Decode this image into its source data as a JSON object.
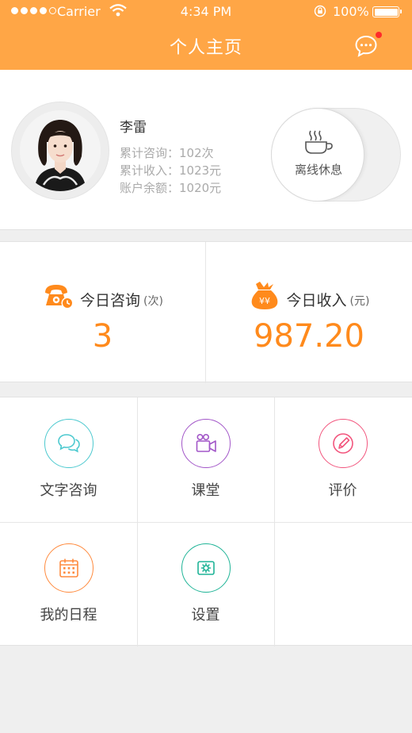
{
  "status_bar": {
    "carrier": "Carrier",
    "time": "4:34 PM",
    "battery": "100%"
  },
  "nav": {
    "title": "个人主页"
  },
  "profile": {
    "name": "李雷",
    "consult_total": "累计咨询：102次",
    "income_total": "累计收入：1023元",
    "balance": "账户余额：1020元"
  },
  "status_toggle": {
    "label": "离线休息"
  },
  "today": {
    "consult": {
      "label": "今日咨询",
      "unit": "(次)",
      "value": "3"
    },
    "income": {
      "label": "今日收入",
      "unit": "(元)",
      "value": "987.20"
    }
  },
  "menu": [
    {
      "label": "文字咨询",
      "icon": "chat-bubbles-icon",
      "color": "#4cc9cf"
    },
    {
      "label": "课堂",
      "icon": "video-camera-icon",
      "color": "#a256c8"
    },
    {
      "label": "评价",
      "icon": "pencil-circle-icon",
      "color": "#f2557d"
    },
    {
      "label": "我的日程",
      "icon": "calendar-icon",
      "color": "#ff8a3d"
    },
    {
      "label": "设置",
      "icon": "gear-icon",
      "color": "#1fb497"
    }
  ],
  "colors": {
    "accent": "#ffa646",
    "number": "#ff8a1c"
  }
}
